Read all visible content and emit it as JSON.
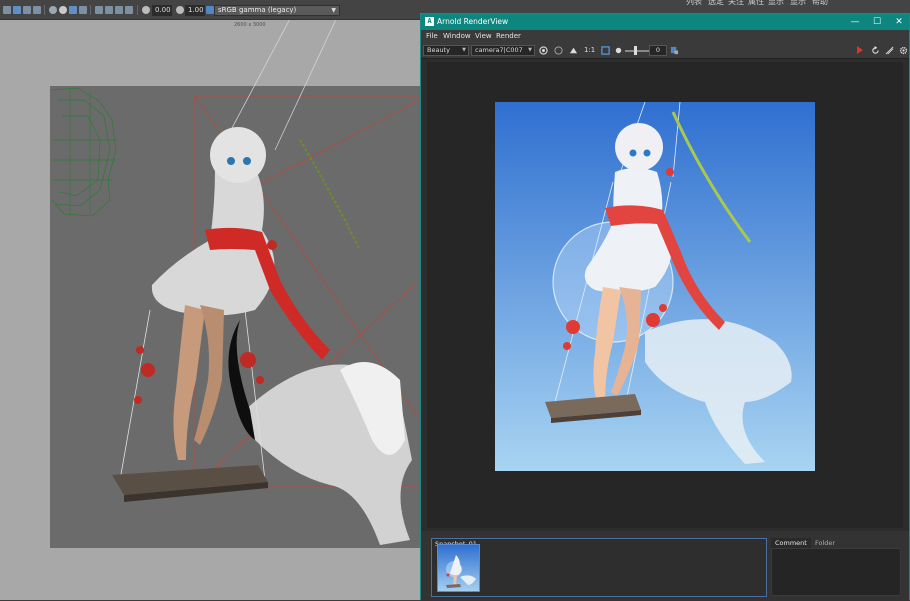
{
  "maya": {
    "top_menu": [
      "列表",
      "选定",
      "关注",
      "属性",
      "显示",
      "显示",
      "帮助"
    ],
    "viewport_toolbar": {
      "value_a": "0.00",
      "value_b": "1.00",
      "color_space": "sRGB gamma (legacy)"
    },
    "resolution_label": "2600 x 3000"
  },
  "renderview": {
    "title": "Arnold RenderView",
    "logo": "A",
    "window_controls": [
      "minimize-icon",
      "maximize-icon",
      "close-icon"
    ],
    "menus": [
      "File",
      "Window",
      "View",
      "Render"
    ],
    "toolbar": {
      "aov": "Beauty",
      "camera": "camera7|C007",
      "ratio": "1:1",
      "exposure": "0"
    },
    "snapshot": {
      "label": "Snapshot_01"
    },
    "side_tabs": [
      "Comment",
      "Folder"
    ]
  },
  "colors": {
    "titlebar": "#0d8680",
    "render_button": "#e0312c",
    "render_bg_top": "#2f6fd0",
    "render_bg_bottom": "#a8d4f2"
  }
}
